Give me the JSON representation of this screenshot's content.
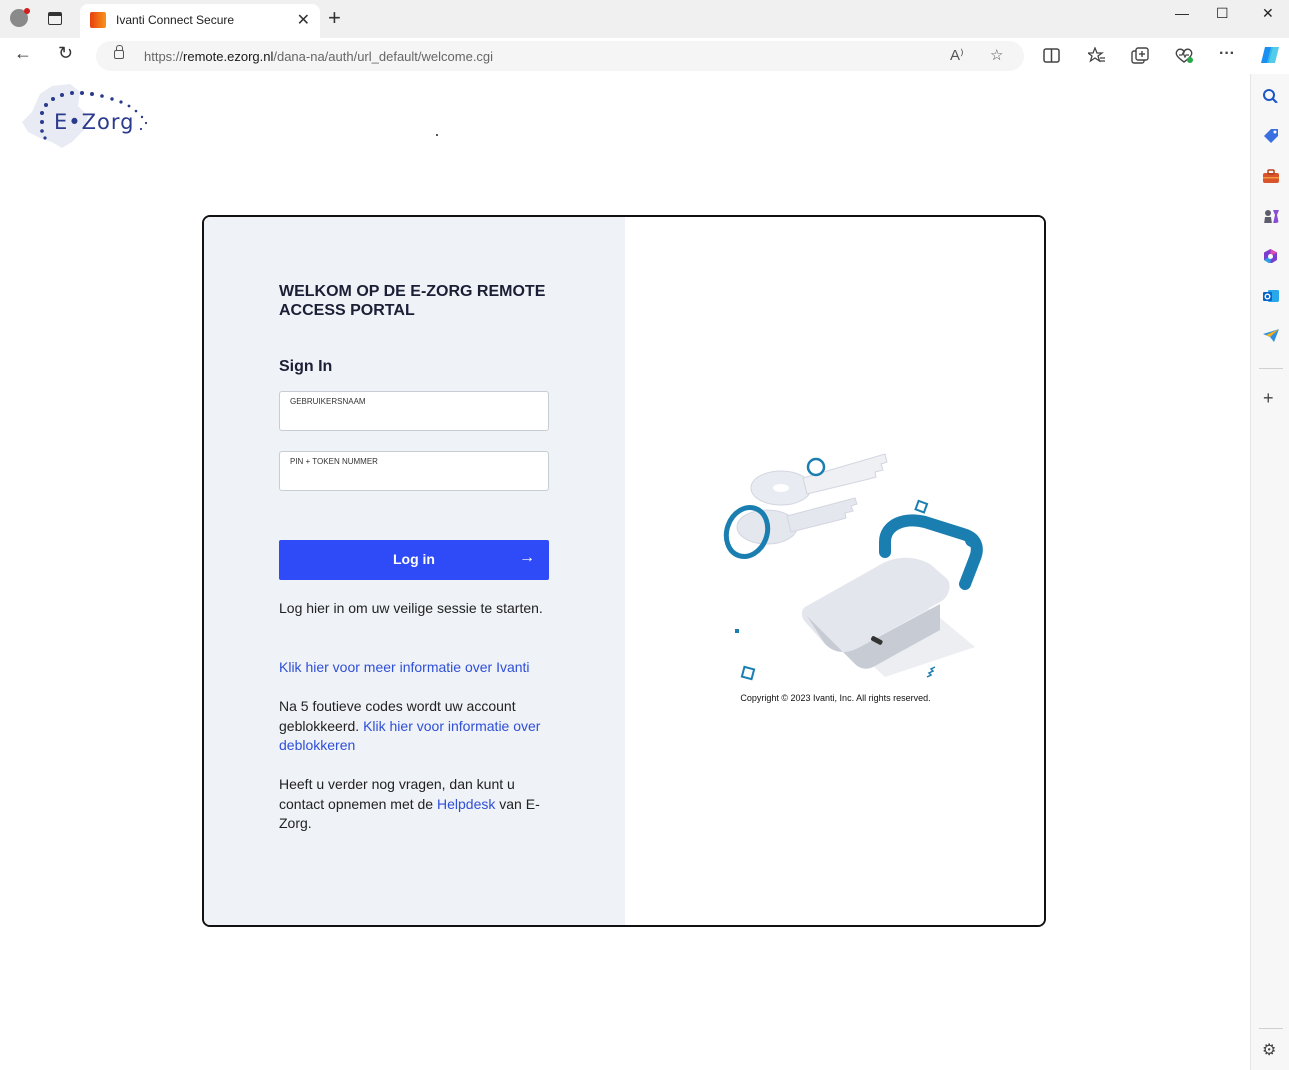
{
  "browser": {
    "tab_title": "Ivanti Connect Secure",
    "tab_close": "✕",
    "new_tab": "+",
    "url_prefix": "https://",
    "url_host": "remote.ezorg.nl",
    "url_path": "/dana-na/auth/url_default/welcome.cgi",
    "window_controls": [
      "—",
      "☐",
      "✕"
    ],
    "nav": {
      "back": "←",
      "refresh": "↻"
    },
    "address_icons": {
      "read_aloud": "A⁾",
      "favorite": "☆"
    },
    "toolbar_icons": [
      "split-screen-icon",
      "favorites-icon",
      "collections-icon",
      "browser-essentials-icon",
      "more-icon",
      "copilot-icon"
    ],
    "more_label": "···"
  },
  "sidebar": {
    "items": [
      "search-icon",
      "shopping-icon",
      "tools-icon",
      "games-icon",
      "microsoft365-icon",
      "outlook-icon",
      "drop-icon"
    ],
    "add_label": "+",
    "settings_label": "⚙"
  },
  "page": {
    "logo_text": "E•Zorg",
    "welcome_title": "WELKOM OP DE E-ZORG REMOTE ACCESS PORTAL",
    "sign_in": "Sign In",
    "username_label": "GEBRUIKERSNAAM",
    "username_value": "",
    "password_label": "PIN + TOKEN NUMMER",
    "password_value": "",
    "login_label": "Log in",
    "login_arrow": "→",
    "info_text": "Log hier in om uw veilige sessie te starten.",
    "ivanti_link": "Klik hier voor meer informatie over Ivanti",
    "blocked_text": "Na 5 foutieve codes wordt uw account geblokkeerd. ",
    "blocked_link": "Klik hier voor informatie over deblokkeren",
    "help_text_pre": "Heeft u verder nog vragen, dan kunt u contact opnemen met de ",
    "help_link": "Helpdesk",
    "help_text_post": " van E-Zorg.",
    "copyright": "Copyright © 2023 Ivanti, Inc. All rights reserved."
  },
  "colors": {
    "primary_button": "#2e4bf7",
    "link": "#2f4fd7",
    "panel_bg": "#eff2f6",
    "accent_teal": "#1a7fb0"
  }
}
